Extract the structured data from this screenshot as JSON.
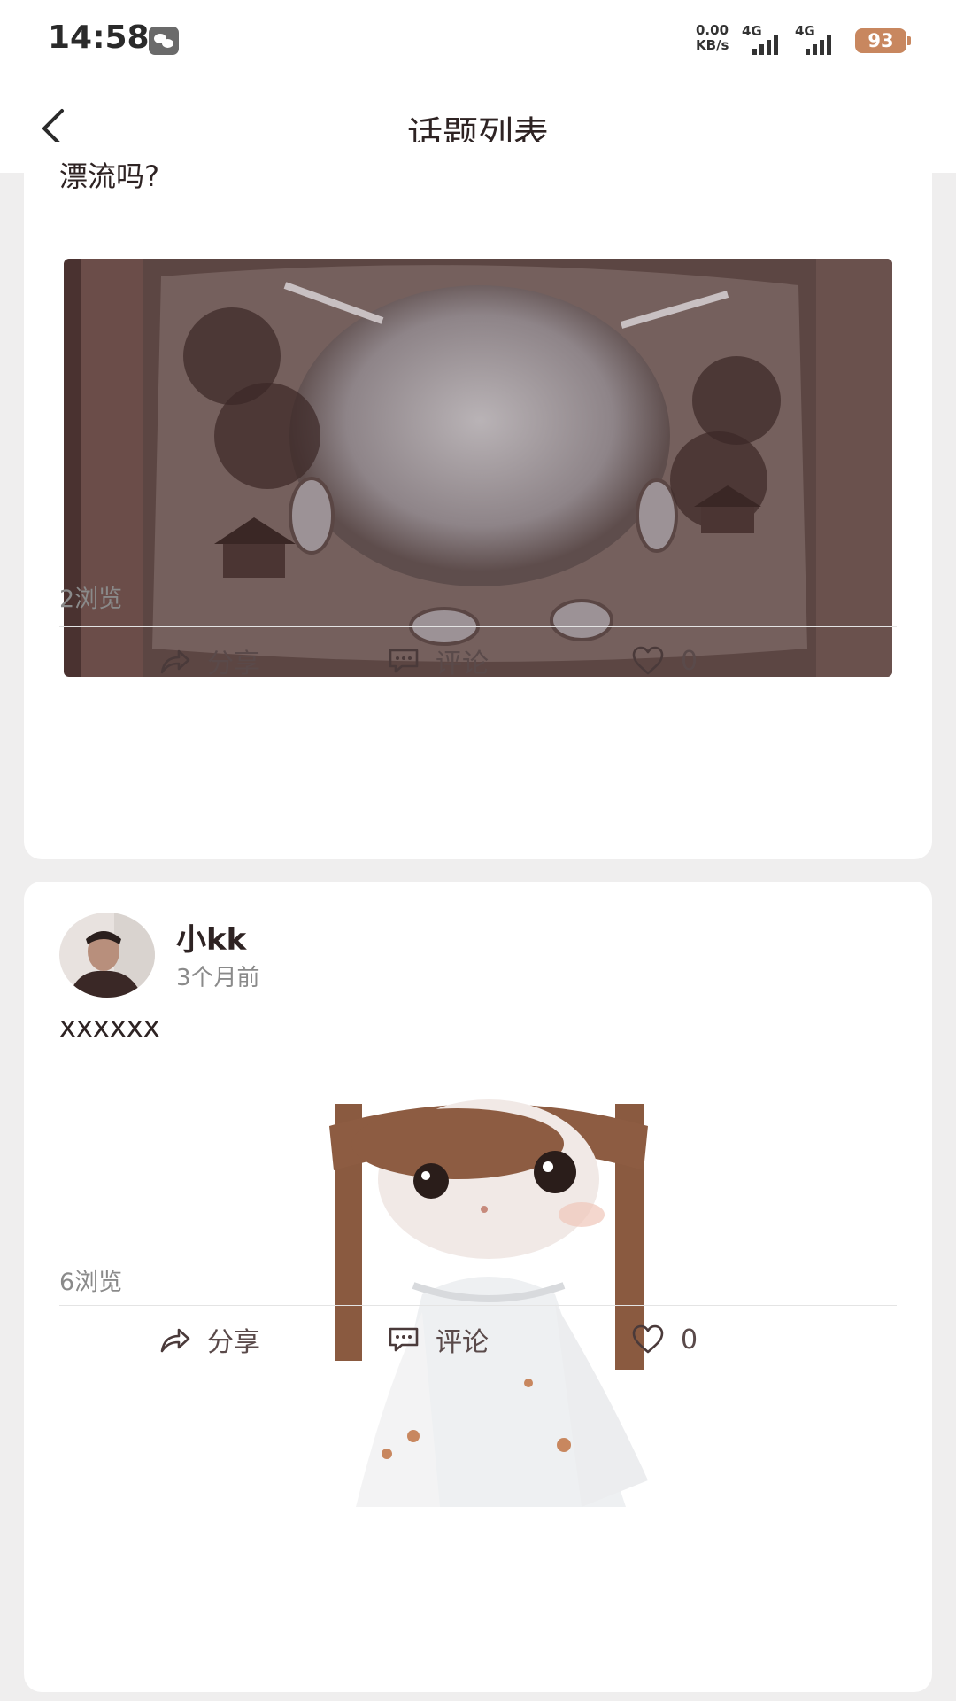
{
  "status_bar": {
    "time": "14:58",
    "net_speed_value": "0.00",
    "net_speed_unit": "KB/s",
    "sim1_label": "4G",
    "sim2_label": "4G",
    "battery": "93",
    "notification_icon": "wechat-icon"
  },
  "header": {
    "title": "话题列表",
    "back_icon": "chevron-left-icon"
  },
  "posts": [
    {
      "text": "漂流吗?",
      "image_desc_icon": "photo",
      "views": "2浏览",
      "actions": {
        "share": "分享",
        "comment": "评论",
        "likes": "0"
      }
    },
    {
      "username": "小kk",
      "time_ago": "3个月前",
      "text": "xxxxxx",
      "views": "6浏览",
      "actions": {
        "share": "分享",
        "comment": "评论",
        "likes": "0"
      }
    }
  ],
  "colors": {
    "background": "#efeeee",
    "card": "#ffffff",
    "title_text": "#2e2323",
    "muted_text": "#8a8a8a",
    "battery": "#c8875f"
  }
}
